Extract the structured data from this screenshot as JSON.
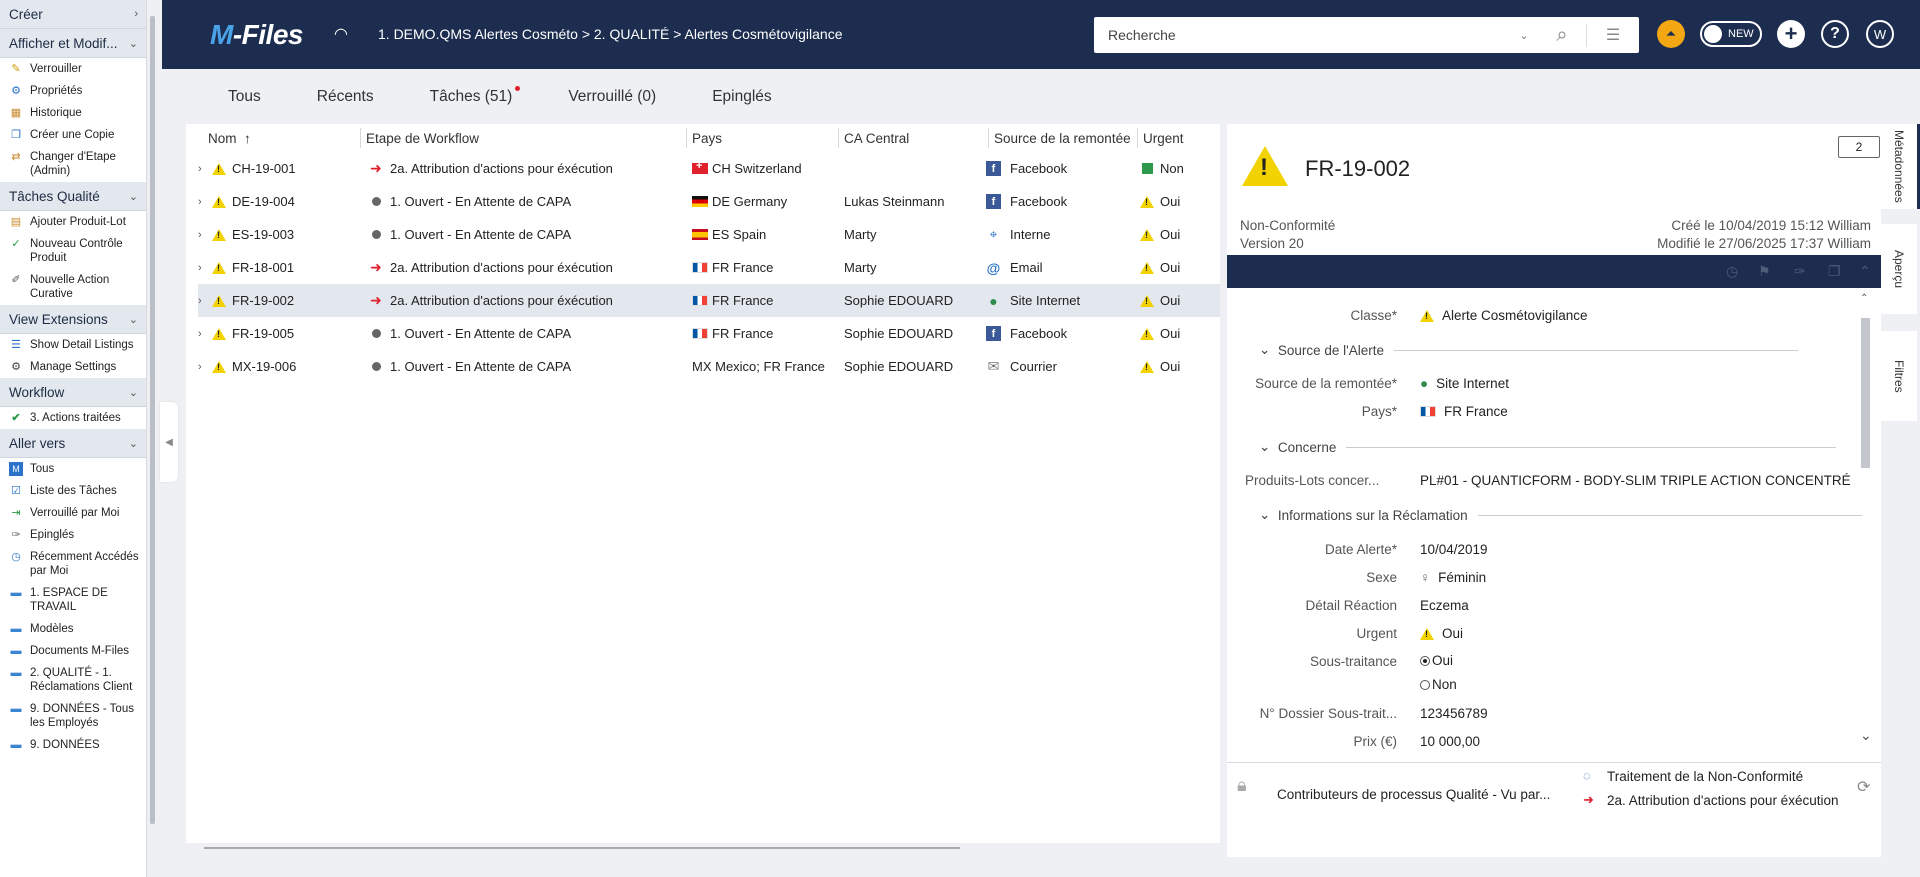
{
  "sidebar": {
    "sections": [
      {
        "label": "Créer",
        "chevron": "›",
        "items": []
      },
      {
        "label": "Afficher et Modif...",
        "chevron": "⌄",
        "items": [
          {
            "label": "Verrouiller",
            "icon": "lock-edit-icon"
          },
          {
            "label": "Propriétés",
            "icon": "properties-icon"
          },
          {
            "label": "Historique",
            "icon": "history-icon"
          },
          {
            "label": "Créer une Copie",
            "icon": "copy-icon"
          },
          {
            "label": "Changer d'Etape (Admin)",
            "icon": "workflow-change-icon"
          }
        ]
      },
      {
        "label": "Tâches Qualité",
        "chevron": "⌄",
        "items": [
          {
            "label": "Ajouter Produit-Lot",
            "icon": "add-product-icon"
          },
          {
            "label": "Nouveau Contrôle Produit",
            "icon": "checkmark-icon"
          },
          {
            "label": "Nouvelle Action Curative",
            "icon": "wrench-icon"
          }
        ]
      },
      {
        "label": "View Extensions",
        "chevron": "⌄",
        "items": [
          {
            "label": "Show Detail Listings",
            "icon": "listing-icon"
          },
          {
            "label": "Manage Settings",
            "icon": "gear-icon"
          }
        ]
      },
      {
        "label": "Workflow",
        "chevron": "⌄",
        "items": [
          {
            "label": "3. Actions traitées",
            "icon": "checkmark-icon"
          }
        ]
      },
      {
        "label": "Aller vers",
        "chevron": "⌄",
        "items": [
          {
            "label": "Tous",
            "icon": "vault-icon"
          },
          {
            "label": "Liste des Tâches",
            "icon": "tasks-icon"
          },
          {
            "label": "Verrouillé par Moi",
            "icon": "checked-out-icon"
          },
          {
            "label": "Epinglés",
            "icon": "pin-icon"
          },
          {
            "label": "Récemment Accédés par Moi",
            "icon": "recent-icon"
          },
          {
            "label": "1. ESPACE DE TRAVAIL",
            "icon": "folder-icon"
          },
          {
            "label": "Modèles",
            "icon": "folder-icon"
          },
          {
            "label": "Documents M-Files",
            "icon": "folder-icon"
          },
          {
            "label": "2. QUALITÉ - 1. Réclamations Client",
            "icon": "folder-icon"
          },
          {
            "label": "9. DONNÉES - Tous les Employés",
            "icon": "folder-icon"
          },
          {
            "label": "9. DONNÉES",
            "icon": "folder-icon"
          }
        ]
      }
    ]
  },
  "header": {
    "logo_prefix": "M",
    "logo_suffix": "-Files",
    "breadcrumb": "1. DEMO.QMS Alertes Cosméto  >  2. QUALITÉ  >  Alertes Cosmétovigilance",
    "search_placeholder": "Recherche",
    "toggle_label": "NEW",
    "user_initial": "W"
  },
  "tabs": [
    {
      "label": "Tous"
    },
    {
      "label": "Récents"
    },
    {
      "label": "Tâches (51)",
      "badge": true
    },
    {
      "label": "Verrouillé (0)"
    },
    {
      "label": "Epinglés"
    }
  ],
  "list": {
    "columns": [
      "Nom",
      "Etape de Workflow",
      "Pays",
      "CA Central",
      "Source de la remontée",
      "Urgent"
    ],
    "sort_indicator": "↑",
    "rows": [
      {
        "name": "CH-19-001",
        "step": "2a. Attribution d'actions pour éxécution",
        "step_icon": "red-arrow",
        "country": "CH Switzerland",
        "flag": "ch",
        "ca": "",
        "source": "Facebook",
        "source_icon": "fb",
        "urgent": "Non",
        "urgent_icon": "green-square"
      },
      {
        "name": "DE-19-004",
        "step": "1. Ouvert - En Attente de CAPA",
        "step_icon": "grey-dot",
        "country": "DE Germany",
        "flag": "de",
        "ca": "Lukas Steinmann",
        "source": "Facebook",
        "source_icon": "fb",
        "urgent": "Oui",
        "urgent_icon": "warning"
      },
      {
        "name": "ES-19-003",
        "step": "1. Ouvert - En Attente de CAPA",
        "step_icon": "grey-dot",
        "country": "ES Spain",
        "flag": "es",
        "ca": "Marty",
        "source": "Interne",
        "source_icon": "pin",
        "urgent": "Oui",
        "urgent_icon": "warning"
      },
      {
        "name": "FR-18-001",
        "step": "2a. Attribution d'actions pour éxécution",
        "step_icon": "red-arrow",
        "country": "FR France",
        "flag": "fr",
        "ca": "Marty",
        "source": "Email",
        "source_icon": "at",
        "urgent": "Oui",
        "urgent_icon": "warning"
      },
      {
        "name": "FR-19-002",
        "step": "2a. Attribution d'actions pour éxécution",
        "step_icon": "red-arrow",
        "country": "FR France",
        "flag": "fr",
        "ca": "Sophie EDOUARD",
        "source": "Site Internet",
        "source_icon": "globe",
        "urgent": "Oui",
        "urgent_icon": "warning",
        "selected": true
      },
      {
        "name": "FR-19-005",
        "step": "1. Ouvert - En Attente de CAPA",
        "step_icon": "grey-dot",
        "country": "FR France",
        "flag": "fr",
        "ca": "Sophie EDOUARD",
        "source": "Facebook",
        "source_icon": "fb",
        "urgent": "Oui",
        "urgent_icon": "warning"
      },
      {
        "name": "MX-19-006",
        "step": "1. Ouvert - En Attente de CAPA",
        "step_icon": "grey-dot",
        "country": "MX Mexico; FR France",
        "flag": "",
        "ca": "Sophie EDOUARD",
        "source": "Courrier",
        "source_icon": "mail",
        "urgent": "Oui",
        "urgent_icon": "warning"
      }
    ]
  },
  "metadata": {
    "title": "FR-19-002",
    "comments_count": "2",
    "object_type": "Non-Conformité",
    "version": "Version 20",
    "created": "Créé le 10/04/2019 15:12 William",
    "modified": "Modifié le 27/06/2025 17:37 William",
    "properties": {
      "classe_label": "Classe*",
      "classe_value": "Alerte Cosmétovigilance",
      "group_source": "Source de l'Alerte",
      "source_label": "Source de la remontée*",
      "source_value": "Site Internet",
      "pays_label": "Pays*",
      "pays_value": "FR France",
      "group_concerne": "Concerne",
      "produits_label": "Produits-Lots concer...",
      "produits_value": "PL#01 - QUANTICFORM - BODY-SLIM TRIPLE ACTION CONCENTRÉ",
      "group_reclamation": "Informations sur la Réclamation",
      "date_label": "Date Alerte*",
      "date_value": "10/04/2019",
      "sexe_label": "Sexe",
      "sexe_value": "Féminin",
      "detail_label": "Détail Réaction",
      "detail_value": "Eczema",
      "urgent_label": "Urgent",
      "urgent_value": "Oui",
      "soustraitance_label": "Sous-traitance",
      "soustraitance_options": [
        "Oui",
        "Non"
      ],
      "soustraitance_selected": "Oui",
      "dossier_label": "N° Dossier Sous-trait...",
      "dossier_value": "123456789",
      "prix_label": "Prix (€)",
      "prix_value": "10 000,00"
    },
    "footer": {
      "permissions": "Contributeurs de processus Qualité - Vu par...",
      "workflow": "Traitement de la Non-Conformité",
      "state": "2a. Attribution d'actions pour éxécution"
    }
  },
  "rail": {
    "tabs": [
      "Métadonnées",
      "Aperçu",
      "Filtres"
    ]
  }
}
